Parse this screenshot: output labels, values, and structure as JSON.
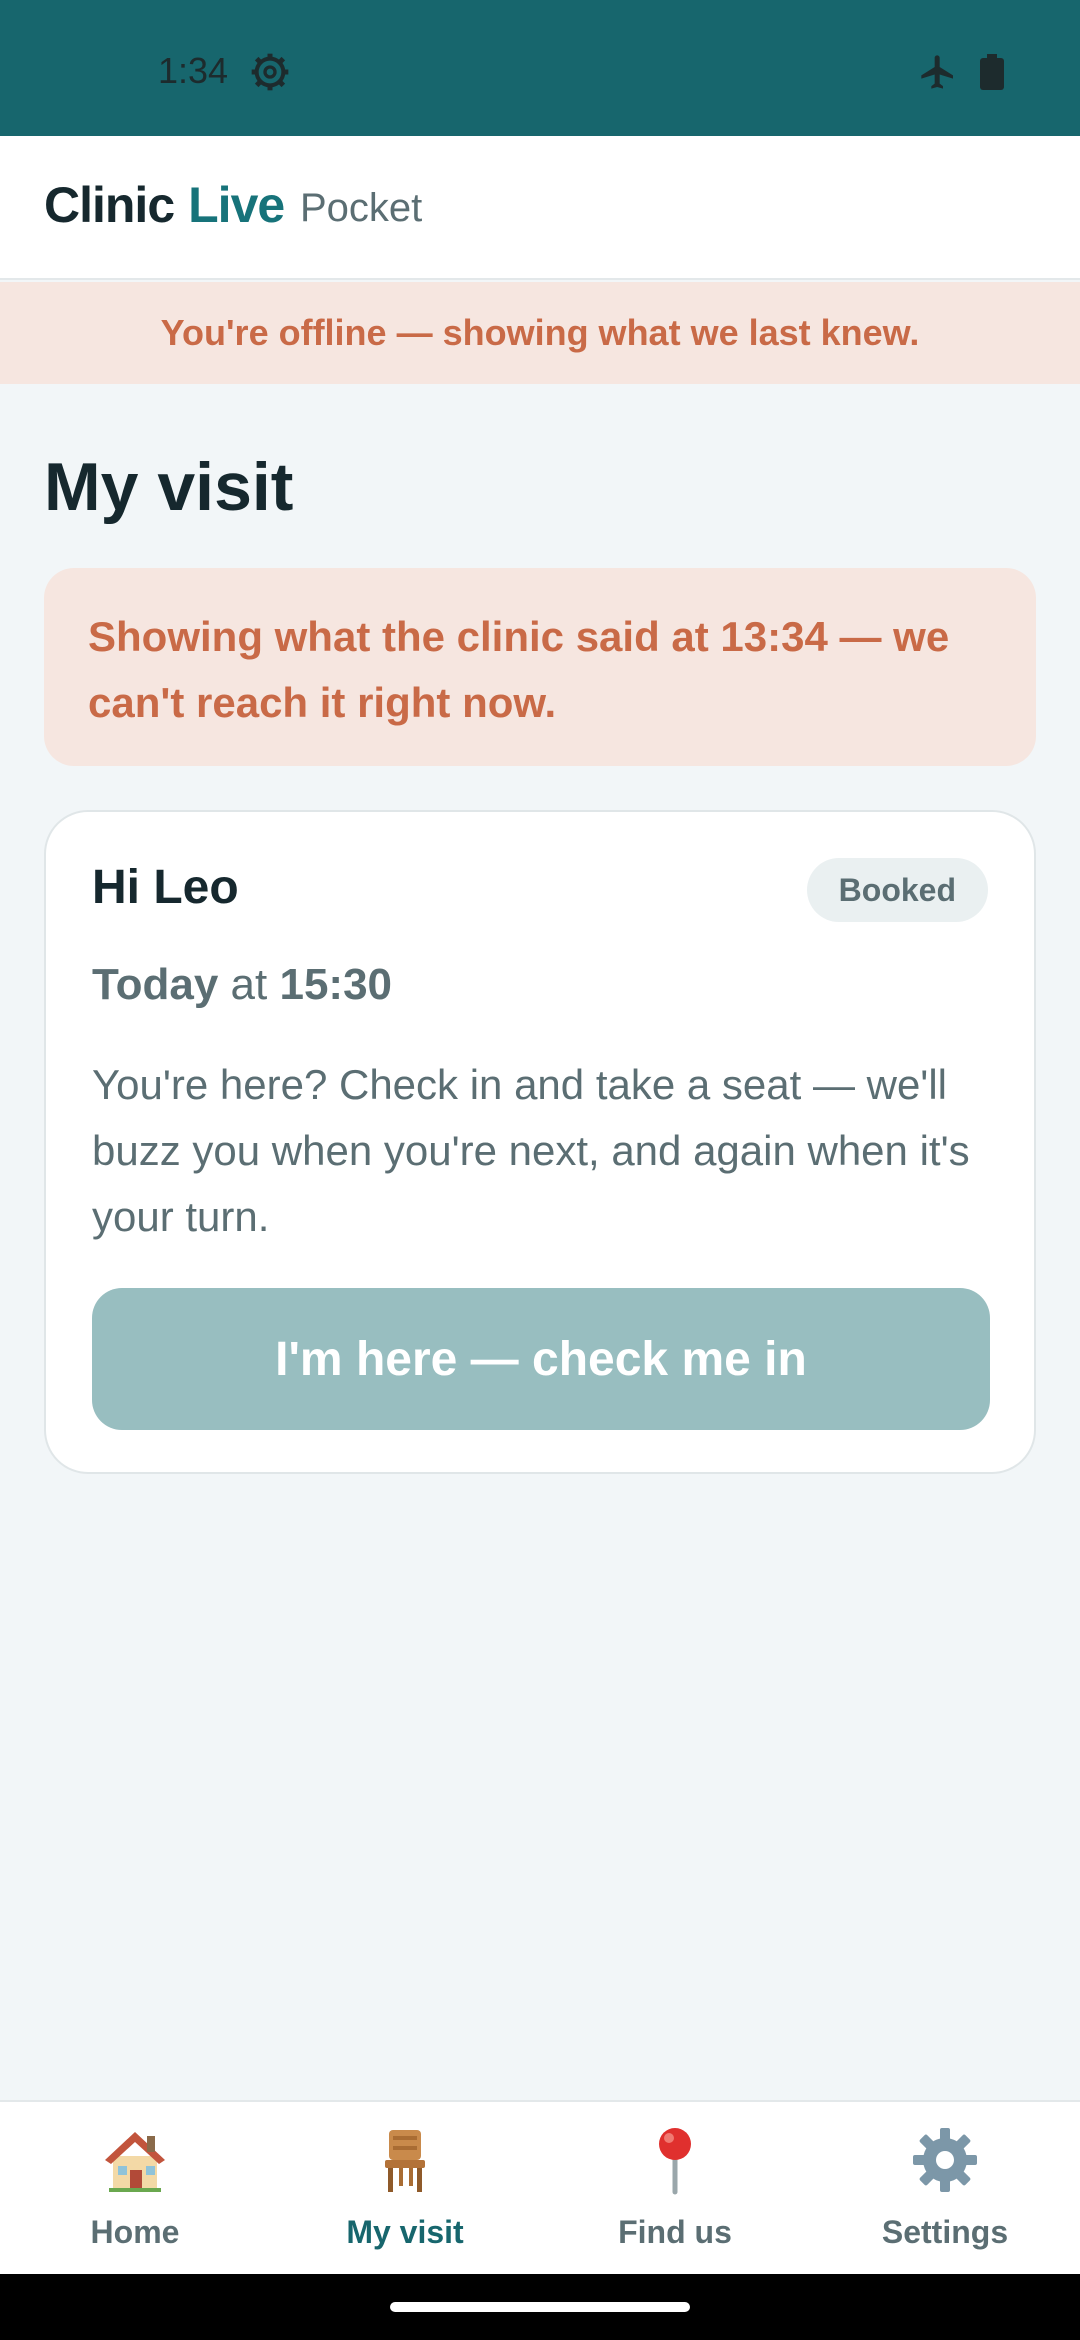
{
  "status_bar": {
    "time": "1:34"
  },
  "header": {
    "brand_part1": "Clinic",
    "brand_part2": "Live",
    "subtitle": "Pocket"
  },
  "offline_banner": {
    "text": "You're offline — showing what we last knew."
  },
  "page": {
    "title": "My visit"
  },
  "stale_notice": {
    "text": "Showing what the clinic said at 13:34 — we can't reach it right now."
  },
  "visit": {
    "greeting": "Hi Leo",
    "status_badge": "Booked",
    "day": "Today",
    "at": "at",
    "time": "15:30",
    "instructions": "You're here? Check in and take a seat — we'll buzz you when you're next, and again when it's your turn.",
    "checkin_label": "I'm here — check me in"
  },
  "nav": {
    "items": [
      {
        "label": "Home",
        "icon": "house-icon"
      },
      {
        "label": "My visit",
        "icon": "chair-icon",
        "active": true
      },
      {
        "label": "Find us",
        "icon": "map-pin-icon"
      },
      {
        "label": "Settings",
        "icon": "gear-icon"
      }
    ]
  },
  "colors": {
    "brand_teal": "#17666d",
    "warning_bg": "#f6e6e0",
    "warning_text": "#c96a47",
    "button_disabled": "#98bec0"
  }
}
